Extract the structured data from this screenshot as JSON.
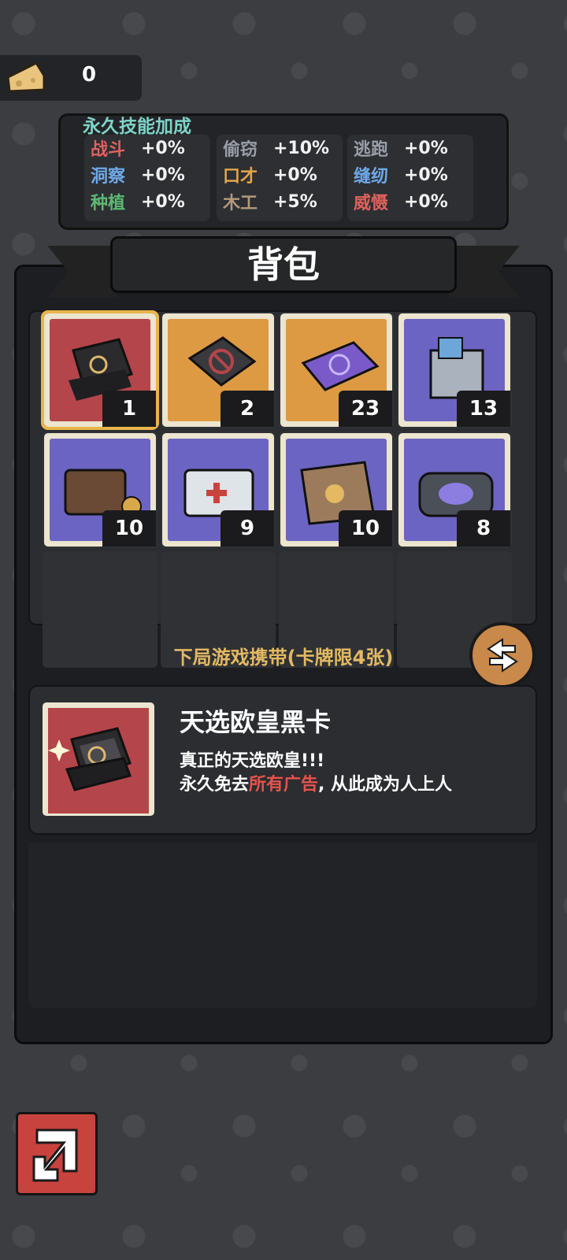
{
  "currency": {
    "icon": "cheese-icon",
    "value": "0"
  },
  "skills": {
    "title": "永久技能加成",
    "columns": [
      [
        {
          "name": "战斗",
          "value": "+0%",
          "color": "#e0625d"
        },
        {
          "name": "洞察",
          "value": "+0%",
          "color": "#6fa9e8"
        },
        {
          "name": "种植",
          "value": "+0%",
          "color": "#5db872"
        }
      ],
      [
        {
          "name": "偷窃",
          "value": "+10%",
          "color": "#9a9ea8"
        },
        {
          "name": "口才",
          "value": "+0%",
          "color": "#e3a54a"
        },
        {
          "name": "木工",
          "value": "+5%",
          "color": "#b59a7b"
        }
      ],
      [
        {
          "name": "逃跑",
          "value": "+0%",
          "color": "#9a9ea8"
        },
        {
          "name": "缝纫",
          "value": "+0%",
          "color": "#6fa9e8"
        },
        {
          "name": "威慑",
          "value": "+0%",
          "color": "#e0625d"
        }
      ]
    ]
  },
  "bag": {
    "title": "背包",
    "items": [
      {
        "name": "black-card-box",
        "count": "1",
        "bg": "red",
        "selected": true
      },
      {
        "name": "no-ads-box",
        "count": "2",
        "bg": "orange"
      },
      {
        "name": "purple-wallet",
        "count": "23",
        "bg": "orange"
      },
      {
        "name": "money-bag",
        "count": "13",
        "bg": "purple"
      },
      {
        "name": "leather-wallet",
        "count": "10",
        "bg": "purple"
      },
      {
        "name": "first-aid-kit",
        "count": "9",
        "bg": "purple"
      },
      {
        "name": "paper-bag",
        "count": "10",
        "bg": "purple"
      },
      {
        "name": "pouch",
        "count": "8",
        "bg": "purple"
      }
    ]
  },
  "carry_label": "下局游戏携带(卡牌限4张)",
  "detail": {
    "name": "天选欧皇黑卡",
    "line1": "真正的天选欧皇!!!",
    "line2_pre": "永久免去",
    "line2_hl": "所有广告",
    "line2_post": ", 从此成为人上人"
  }
}
